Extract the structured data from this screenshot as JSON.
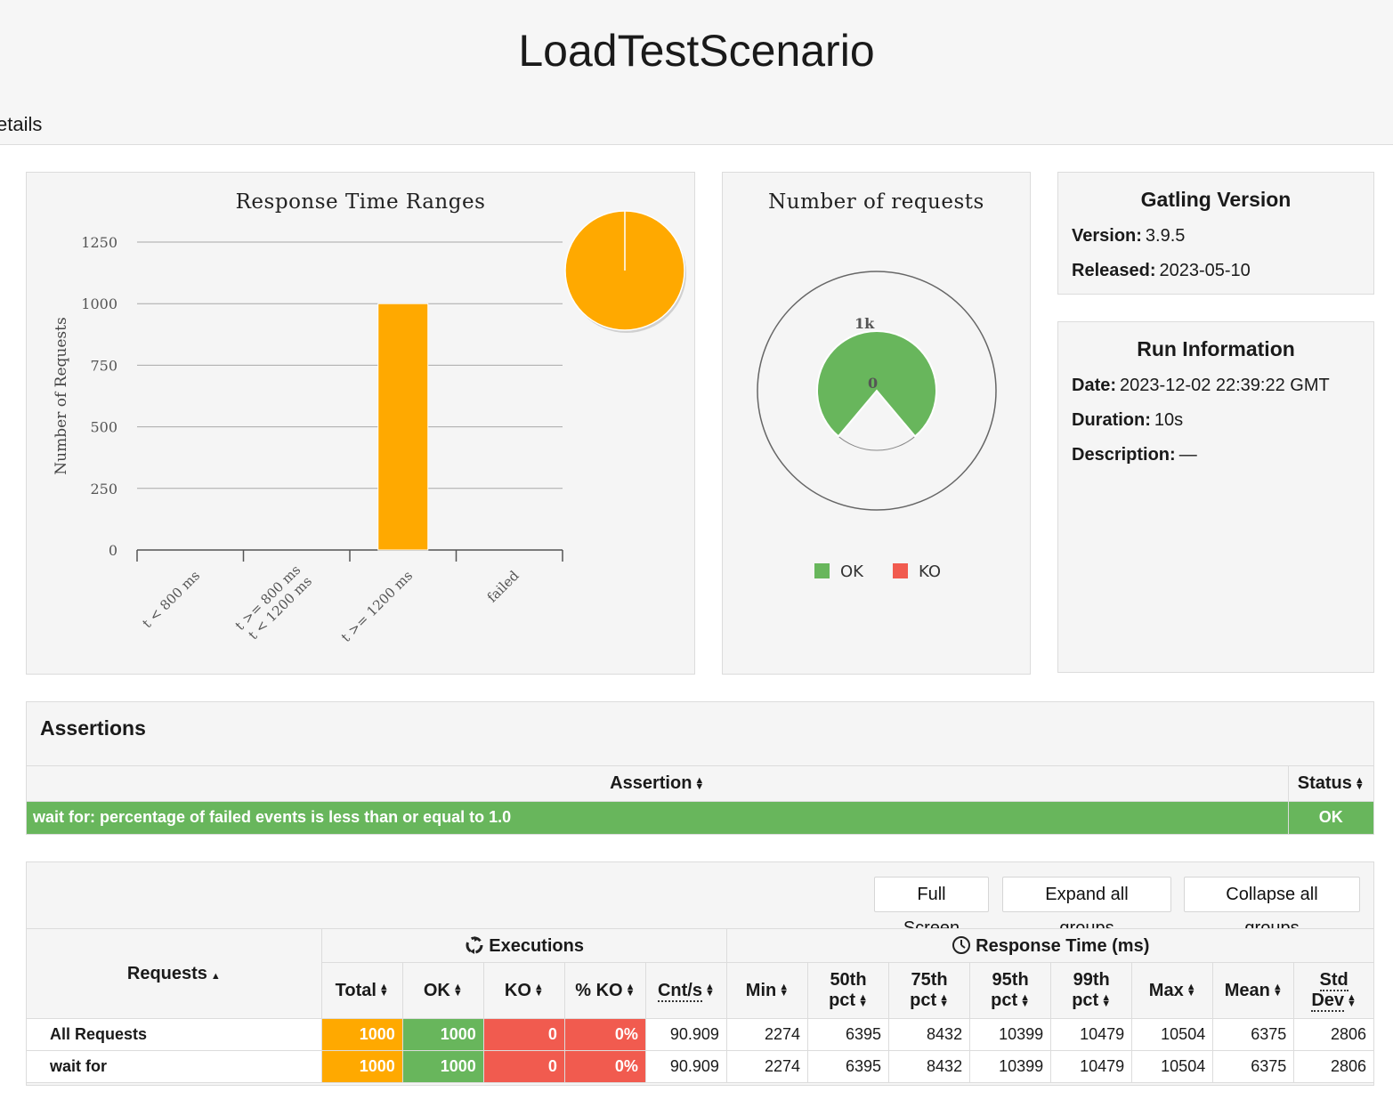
{
  "header": {
    "title": "LoadTestScenario",
    "menu_item": "etails"
  },
  "response_time_chart": {
    "title": "Response Time Ranges",
    "ylabel": "Number of Requests",
    "y_ticks": [
      "0",
      "250",
      "500",
      "750",
      "1000",
      "1250"
    ],
    "categories": [
      "t < 800 ms",
      "t >= 800 ms\nt < 1200 ms",
      "t >= 1200 ms",
      "failed"
    ],
    "colors": {
      "bar": "#ffa900"
    }
  },
  "requests_chart": {
    "title": "Number of requests",
    "tick_labels": [
      "0",
      "1k"
    ],
    "legend": [
      {
        "label": "OK",
        "color": "#68b65c"
      },
      {
        "label": "KO",
        "color": "#f15b4f"
      }
    ]
  },
  "chart_data": [
    {
      "type": "bar",
      "title": "Response Time Ranges",
      "ylabel": "Number of Requests",
      "xlabel": "",
      "categories": [
        "t < 800 ms",
        "t >= 800 ms t < 1200 ms",
        "t >= 1200 ms",
        "failed"
      ],
      "values": [
        0,
        0,
        1000,
        0
      ],
      "ylim": [
        0,
        1250
      ],
      "grid": true
    },
    {
      "type": "pie",
      "labels": [
        "t >= 1200 ms"
      ],
      "values": [
        1000
      ]
    },
    {
      "type": "pie",
      "title": "Number of requests",
      "labels": [
        "OK",
        "KO"
      ],
      "values": [
        1000,
        0
      ],
      "legend_placement": "bottom"
    }
  ],
  "gatling": {
    "title": "Gatling Version",
    "version_label": "Version:",
    "version": "3.9.5",
    "released_label": "Released:",
    "released": "2023-05-10"
  },
  "run_info": {
    "title": "Run Information",
    "date_label": "Date:",
    "date": "2023-12-02 22:39:22 GMT",
    "duration_label": "Duration:",
    "duration": "10s",
    "description_label": "Description:",
    "description": "—"
  },
  "assertions": {
    "heading": "Assertions",
    "col_assertion": "Assertion",
    "col_status": "Status",
    "rows": [
      {
        "assertion": "wait for: percentage of failed events is less than or equal to 1.0",
        "status": "OK"
      }
    ]
  },
  "stats": {
    "buttons": {
      "full_screen": "Full Screen",
      "expand": "Expand all groups",
      "collapse": "Collapse all groups"
    },
    "group_executions": "Executions",
    "group_response": "Response Time (ms)",
    "headers": {
      "requests": "Requests",
      "total": "Total",
      "ok": "OK",
      "ko": "KO",
      "pct_ko": "% KO",
      "cnts": "Cnt/s",
      "min": "Min",
      "p50a": "50th",
      "p50b": "pct",
      "p75a": "75th",
      "p75b": "pct",
      "p95a": "95th",
      "p95b": "pct",
      "p99a": "99th",
      "p99b": "pct",
      "max": "Max",
      "mean": "Mean",
      "stda": "Std",
      "stdb": "Dev"
    },
    "rows": [
      {
        "name": "All Requests",
        "total": "1000",
        "ok": "1000",
        "ko": "0",
        "pct_ko": "0%",
        "cnts": "90.909",
        "min": "2274",
        "p50": "6395",
        "p75": "8432",
        "p95": "10399",
        "p99": "10479",
        "max": "10504",
        "mean": "6375",
        "std": "2806"
      },
      {
        "name": "wait for",
        "total": "1000",
        "ok": "1000",
        "ko": "0",
        "pct_ko": "0%",
        "cnts": "90.909",
        "min": "2274",
        "p50": "6395",
        "p75": "8432",
        "p95": "10399",
        "p99": "10479",
        "max": "10504",
        "mean": "6375",
        "std": "2806"
      }
    ]
  }
}
